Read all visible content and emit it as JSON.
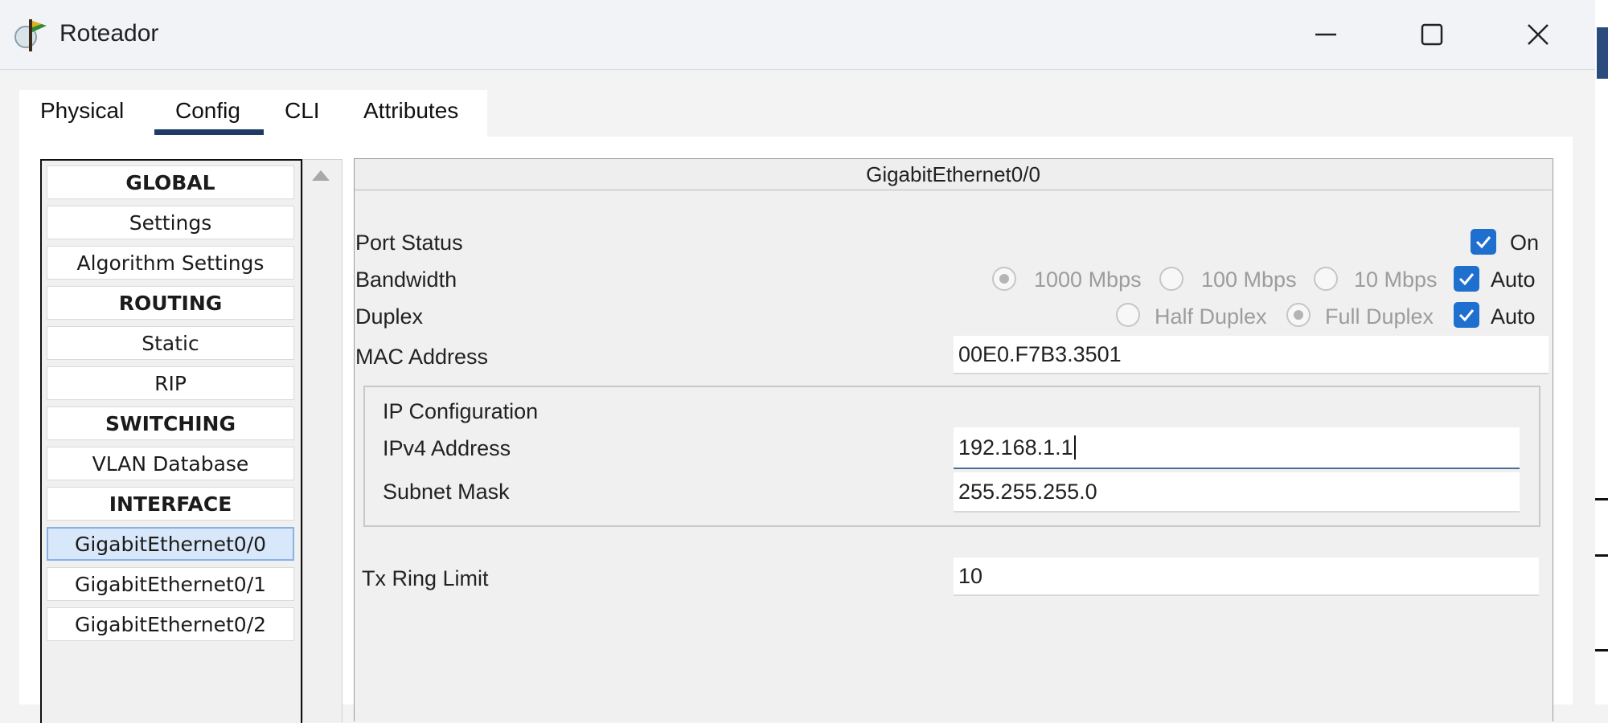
{
  "window": {
    "title": "Roteador",
    "icons": {
      "app": "router-app-icon",
      "minimize": "minimize-icon",
      "maximize": "maximize-icon",
      "close": "close-icon"
    }
  },
  "tabs": [
    {
      "label": "Physical"
    },
    {
      "label": "Config",
      "active": true
    },
    {
      "label": "CLI"
    },
    {
      "label": "Attributes"
    }
  ],
  "nav": {
    "items": [
      {
        "label": "GLOBAL",
        "header": true
      },
      {
        "label": "Settings"
      },
      {
        "label": "Algorithm Settings"
      },
      {
        "label": "ROUTING",
        "header": true
      },
      {
        "label": "Static"
      },
      {
        "label": "RIP"
      },
      {
        "label": "SWITCHING",
        "header": true
      },
      {
        "label": "VLAN Database"
      },
      {
        "label": "INTERFACE",
        "header": true
      },
      {
        "label": "GigabitEthernet0/0",
        "selected": true
      },
      {
        "label": "GigabitEthernet0/1"
      },
      {
        "label": "GigabitEthernet0/2"
      }
    ]
  },
  "panel": {
    "title": "GigabitEthernet0/0",
    "port_status": {
      "label": "Port Status",
      "on_label": "On",
      "on_checked": true
    },
    "bandwidth": {
      "label": "Bandwidth",
      "options": [
        "1000 Mbps",
        "100 Mbps",
        "10 Mbps"
      ],
      "selected": "1000 Mbps",
      "auto_label": "Auto",
      "auto_checked": true
    },
    "duplex": {
      "label": "Duplex",
      "options": [
        "Half Duplex",
        "Full Duplex"
      ],
      "selected": "Full Duplex",
      "auto_label": "Auto",
      "auto_checked": true
    },
    "mac": {
      "label": "MAC Address",
      "value": "00E0.F7B3.3501"
    },
    "ip_config": {
      "title": "IP Configuration",
      "ipv4_label": "IPv4 Address",
      "ipv4_value": "192.168.1.1",
      "mask_label": "Subnet Mask",
      "mask_value": "255.255.255.0"
    },
    "tx_ring": {
      "label": "Tx Ring Limit",
      "value": "10"
    }
  },
  "colors": {
    "accent": "#1e6fce",
    "tab_underline": "#1d3b66",
    "selected_item": "#d8e7f9"
  }
}
